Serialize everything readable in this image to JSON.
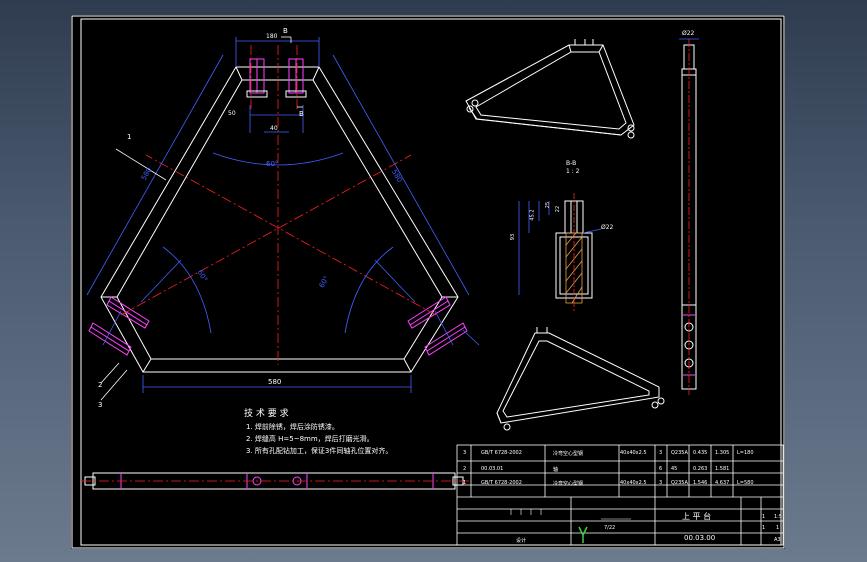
{
  "drawing": {
    "dims": {
      "top_width": "180",
      "top_small": "40",
      "top_gap": "50",
      "left_len": "580",
      "right_len": "580",
      "bottom_len": "580",
      "inner_angle": "60°",
      "angle_left": "60°",
      "angle_right": "60°",
      "section_dia": "Ø22",
      "section_h1": "25",
      "section_h2": "45.2",
      "section_h3": "93",
      "section_h4": "22",
      "side_dia": "Ø22"
    },
    "section_label": "B-B",
    "section_scale": "1 : 2",
    "section_mark_top": "B",
    "section_mark_bottom": "B",
    "callouts": [
      "1",
      "2",
      "3"
    ]
  },
  "tech": {
    "title": "技 术 要 求",
    "items": [
      "1. 焊前除锈，焊后涂防锈漆。",
      "2. 焊缝高 H=5~8mm，焊后打磨光滑。",
      "3. 所有孔配钻加工，保证3件同轴孔位置对齐。"
    ]
  },
  "bom": {
    "rows": [
      {
        "no": "3",
        "code": "GB/T 6728-2002",
        "name": "冷弯空心型钢",
        "spec": "40x40x2.5",
        "qty": "3",
        "mat": "Q235A",
        "w1": "0.435",
        "w2": "1.305",
        "note": "L=180"
      },
      {
        "no": "2",
        "code": "00.03.01",
        "name": "轴",
        "spec": "",
        "qty": "6",
        "mat": "45",
        "w1": "0.263",
        "w2": "1.581",
        "note": ""
      },
      {
        "no": "1",
        "code": "GB/T 6728-2002",
        "name": "冷弯空心型钢",
        "spec": "40x40x2.5",
        "qty": "3",
        "mat": "Q235A",
        "w1": "1.546",
        "w2": "4.637",
        "note": "L=580"
      }
    ]
  },
  "titleblock": {
    "name": "上 平 台",
    "code": "00.03.00",
    "scale": "1:5",
    "size": "A3",
    "count": "1",
    "sheet": "1",
    "total": "1",
    "designer": "设计",
    "date": "7/22"
  }
}
